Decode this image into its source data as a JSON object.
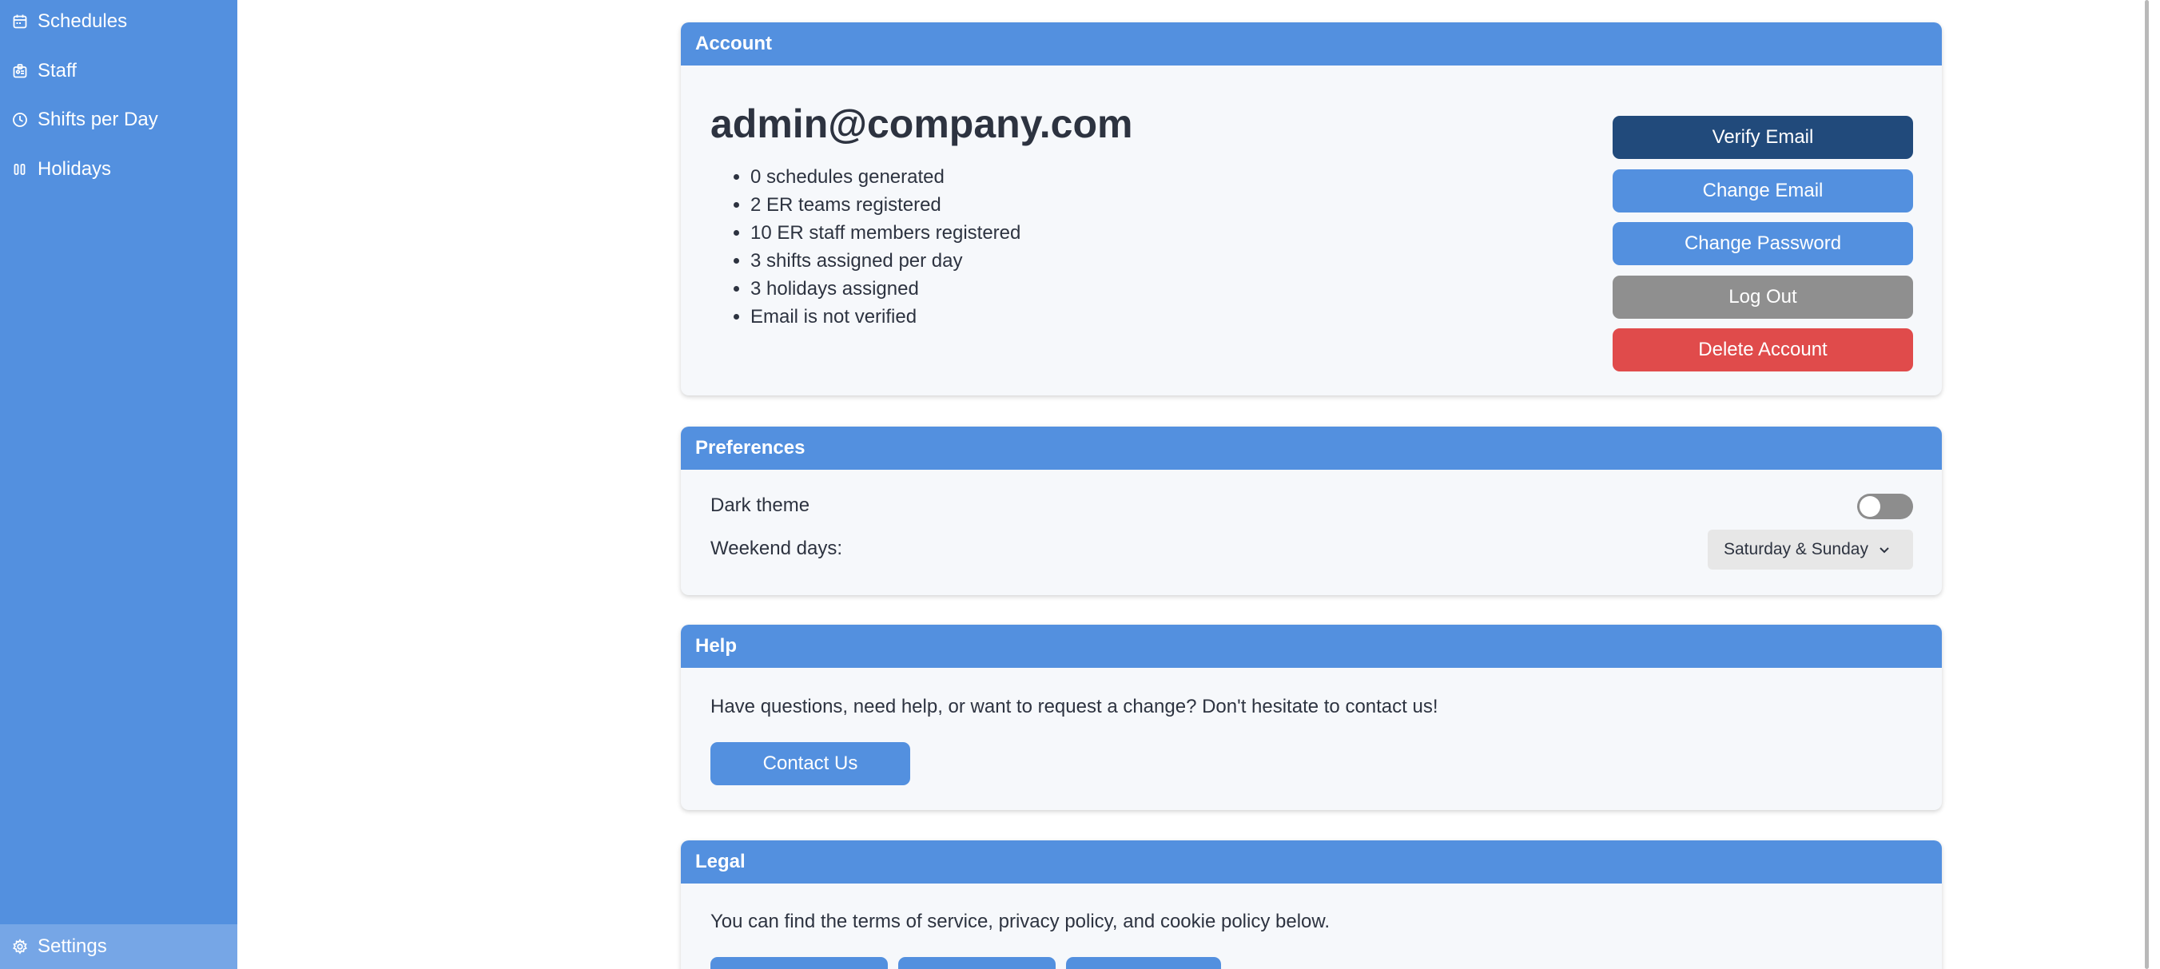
{
  "sidebar": {
    "items": [
      {
        "label": "Schedules",
        "icon": "calendar-icon"
      },
      {
        "label": "Staff",
        "icon": "id-badge-icon"
      },
      {
        "label": "Shifts per Day",
        "icon": "clock-icon"
      },
      {
        "label": "Holidays",
        "icon": "holiday-icon"
      }
    ],
    "settings": {
      "label": "Settings",
      "icon": "gear-icon"
    }
  },
  "account": {
    "header": "Account",
    "email": "admin@company.com",
    "stats": [
      "0 schedules generated",
      "2 ER teams registered",
      "10 ER staff members registered",
      "3 shifts assigned per day",
      "3 holidays assigned",
      "Email is not verified"
    ],
    "buttons": {
      "verify_email": "Verify Email",
      "change_email": "Change Email",
      "change_password": "Change Password",
      "log_out": "Log Out",
      "delete_account": "Delete Account"
    }
  },
  "preferences": {
    "header": "Preferences",
    "dark_theme_label": "Dark theme",
    "dark_theme_enabled": false,
    "weekend_label": "Weekend days:",
    "weekend_value": "Saturday & Sunday"
  },
  "help": {
    "header": "Help",
    "text": "Have questions, need help, or want to request a change? Don't hesitate to contact us!",
    "contact_button": "Contact Us"
  },
  "legal": {
    "header": "Legal",
    "text": "You can find the terms of service, privacy policy, and cookie policy below."
  },
  "colors": {
    "accent": "#5390df",
    "sidebar_active": "#76a6e6",
    "verify_button": "#214a7b",
    "logout_button": "#8f8f8f",
    "delete_button": "#e04b4b",
    "text": "#2d3340",
    "card_background": "#f6f8fb"
  }
}
